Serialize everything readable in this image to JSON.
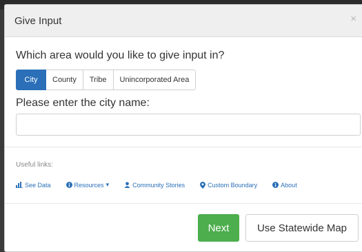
{
  "modal": {
    "title": "Give Input",
    "close_label": "×"
  },
  "area": {
    "question": "Which area would you like to give input in?",
    "options": [
      "City",
      "County",
      "Tribe",
      "Unincorporated Area"
    ],
    "selected": "City"
  },
  "city": {
    "prompt": "Please enter the city name:",
    "value": "",
    "placeholder": ""
  },
  "useful_links": {
    "heading": "Useful links:",
    "items": [
      {
        "label": "See Data",
        "icon": "bar-chart-icon"
      },
      {
        "label": "Resources",
        "icon": "info-icon",
        "caret": "▾"
      },
      {
        "label": "Community Stories",
        "icon": "user-icon"
      },
      {
        "label": "Custom Boundary",
        "icon": "map-marker-icon"
      },
      {
        "label": "About",
        "icon": "info-icon"
      }
    ]
  },
  "footer": {
    "next_label": "Next",
    "statewide_label": "Use Statewide Map"
  },
  "colors": {
    "primary": "#2a6fb8",
    "success": "#4cae4c"
  }
}
